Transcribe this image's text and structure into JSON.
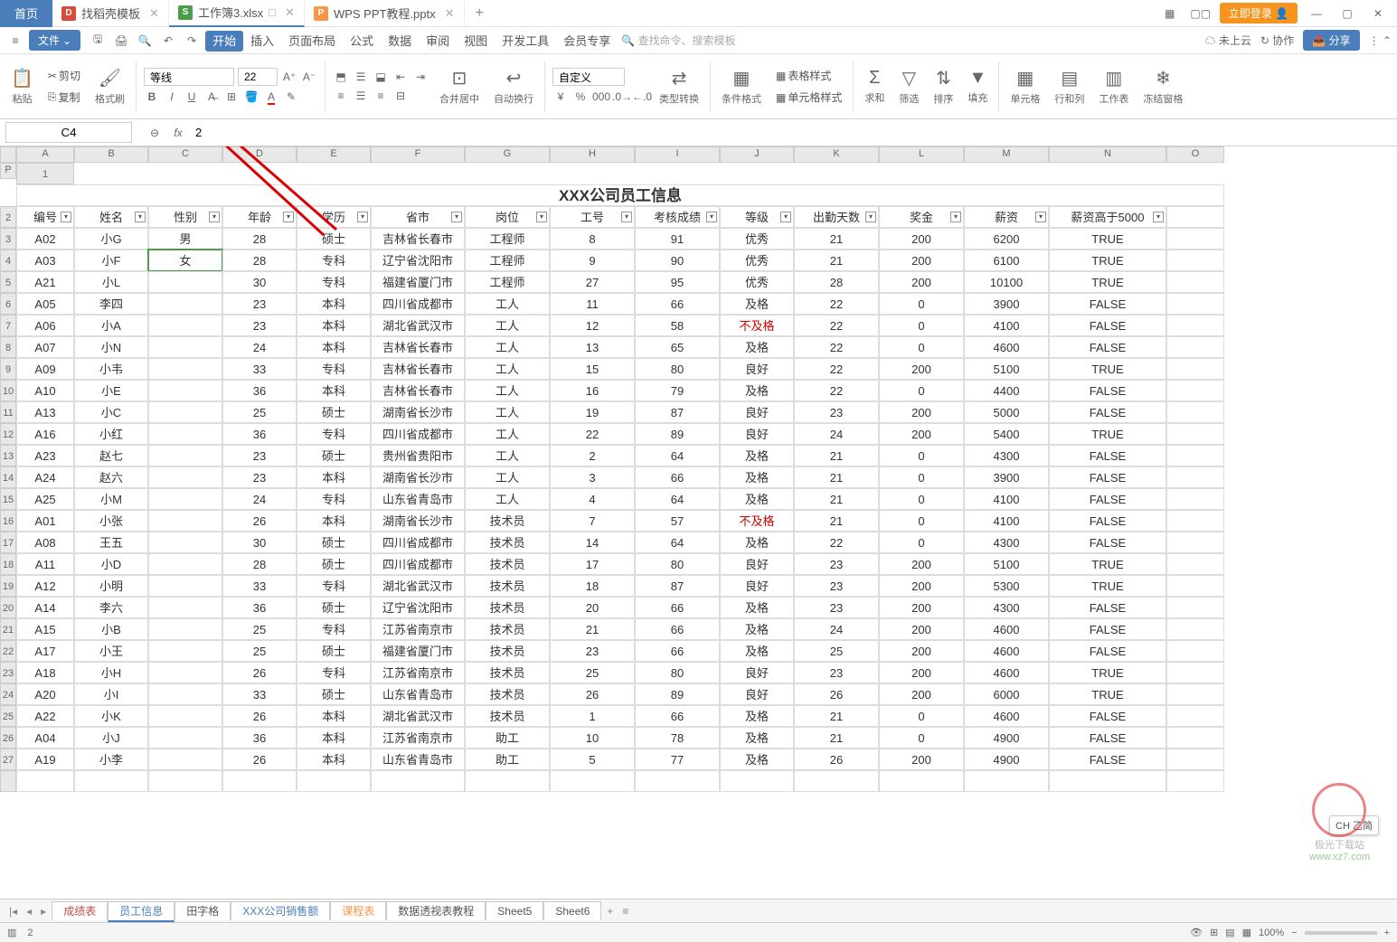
{
  "titlebar": {
    "home": "首页",
    "tabs": [
      {
        "icon_bg": "#d94b3a",
        "icon_text": "D",
        "label": "找稻壳模板"
      },
      {
        "icon_bg": "#4a9e4a",
        "icon_text": "S",
        "label": "工作簿3.xlsx",
        "active": true,
        "modified": "□"
      },
      {
        "icon_bg": "#f79646",
        "icon_text": "P",
        "label": "WPS PPT教程.pptx"
      }
    ],
    "login": "立即登录",
    "minimize": "—",
    "maximize": "▢",
    "close": "✕"
  },
  "menubar": {
    "file": "文件",
    "tabs": [
      "开始",
      "插入",
      "页面布局",
      "公式",
      "数据",
      "审阅",
      "视图",
      "开发工具",
      "会员专享"
    ],
    "active_index": 0,
    "search_placeholder": "查找命令、搜索模板",
    "cloud": "未上云",
    "collab": "协作",
    "share": "分享"
  },
  "ribbon": {
    "cut": "剪切",
    "copy": "复制",
    "paste": "粘贴",
    "format_painter": "格式刷",
    "font_name": "等线",
    "font_size": "22",
    "merge": "合并居中",
    "wrap": "自动换行",
    "number_format": "自定义",
    "type_convert": "类型转换",
    "cond_format": "条件格式",
    "table_style": "表格样式",
    "cell_style": "单元格样式",
    "sum": "求和",
    "filter": "筛选",
    "sort": "排序",
    "fill": "填充",
    "cells": "单元格",
    "rows_cols": "行和列",
    "sheet": "工作表",
    "freeze": "冻结窗格"
  },
  "namebox": {
    "ref": "C4",
    "formula": "2"
  },
  "col_letters": [
    "",
    "A",
    "B",
    "C",
    "D",
    "E",
    "F",
    "G",
    "H",
    "I",
    "J",
    "K",
    "L",
    "M",
    "N",
    "O",
    "P"
  ],
  "title_text": "XXX公司员工信息",
  "headers": [
    "编号",
    "姓名",
    "性别",
    "年龄",
    "学历",
    "省市",
    "岗位",
    "工号",
    "考核成绩",
    "等级",
    "出勤天数",
    "奖金",
    "薪资",
    "薪资高于5000"
  ],
  "rows": [
    {
      "n": 3,
      "d": [
        "A02",
        "小G",
        "男",
        "28",
        "硕士",
        "吉林省长春市",
        "工程师",
        "8",
        "91",
        "优秀",
        "21",
        "200",
        "6200",
        "TRUE"
      ]
    },
    {
      "n": 4,
      "d": [
        "A03",
        "小F",
        "女",
        "28",
        "专科",
        "辽宁省沈阳市",
        "工程师",
        "9",
        "90",
        "优秀",
        "21",
        "200",
        "6100",
        "TRUE"
      ],
      "sel": 2
    },
    {
      "n": 5,
      "d": [
        "A21",
        "小L",
        "",
        "30",
        "专科",
        "福建省厦门市",
        "工程师",
        "27",
        "95",
        "优秀",
        "28",
        "200",
        "10100",
        "TRUE"
      ]
    },
    {
      "n": 6,
      "d": [
        "A05",
        "李四",
        "",
        "23",
        "本科",
        "四川省成都市",
        "工人",
        "11",
        "66",
        "及格",
        "22",
        "0",
        "3900",
        "FALSE"
      ]
    },
    {
      "n": 7,
      "d": [
        "A06",
        "小A",
        "",
        "23",
        "本科",
        "湖北省武汉市",
        "工人",
        "12",
        "58",
        "不及格",
        "22",
        "0",
        "4100",
        "FALSE"
      ],
      "red": 9
    },
    {
      "n": 8,
      "d": [
        "A07",
        "小N",
        "",
        "24",
        "本科",
        "吉林省长春市",
        "工人",
        "13",
        "65",
        "及格",
        "22",
        "0",
        "4600",
        "FALSE"
      ]
    },
    {
      "n": 9,
      "d": [
        "A09",
        "小韦",
        "",
        "33",
        "专科",
        "吉林省长春市",
        "工人",
        "15",
        "80",
        "良好",
        "22",
        "200",
        "5100",
        "TRUE"
      ]
    },
    {
      "n": 10,
      "d": [
        "A10",
        "小E",
        "",
        "36",
        "本科",
        "吉林省长春市",
        "工人",
        "16",
        "79",
        "及格",
        "22",
        "0",
        "4400",
        "FALSE"
      ]
    },
    {
      "n": 11,
      "d": [
        "A13",
        "小C",
        "",
        "25",
        "硕士",
        "湖南省长沙市",
        "工人",
        "19",
        "87",
        "良好",
        "23",
        "200",
        "5000",
        "FALSE"
      ]
    },
    {
      "n": 12,
      "d": [
        "A16",
        "小红",
        "",
        "36",
        "专科",
        "四川省成都市",
        "工人",
        "22",
        "89",
        "良好",
        "24",
        "200",
        "5400",
        "TRUE"
      ]
    },
    {
      "n": 13,
      "d": [
        "A23",
        "赵七",
        "",
        "23",
        "硕士",
        "贵州省贵阳市",
        "工人",
        "2",
        "64",
        "及格",
        "21",
        "0",
        "4300",
        "FALSE"
      ]
    },
    {
      "n": 14,
      "d": [
        "A24",
        "赵六",
        "",
        "23",
        "本科",
        "湖南省长沙市",
        "工人",
        "3",
        "66",
        "及格",
        "21",
        "0",
        "3900",
        "FALSE"
      ]
    },
    {
      "n": 15,
      "d": [
        "A25",
        "小M",
        "",
        "24",
        "专科",
        "山东省青岛市",
        "工人",
        "4",
        "64",
        "及格",
        "21",
        "0",
        "4100",
        "FALSE"
      ]
    },
    {
      "n": 16,
      "d": [
        "A01",
        "小张",
        "",
        "26",
        "本科",
        "湖南省长沙市",
        "技术员",
        "7",
        "57",
        "不及格",
        "21",
        "0",
        "4100",
        "FALSE"
      ],
      "red": 9
    },
    {
      "n": 17,
      "d": [
        "A08",
        "王五",
        "",
        "30",
        "硕士",
        "四川省成都市",
        "技术员",
        "14",
        "64",
        "及格",
        "22",
        "0",
        "4300",
        "FALSE"
      ]
    },
    {
      "n": 18,
      "d": [
        "A11",
        "小D",
        "",
        "28",
        "硕士",
        "四川省成都市",
        "技术员",
        "17",
        "80",
        "良好",
        "23",
        "200",
        "5100",
        "TRUE"
      ]
    },
    {
      "n": 19,
      "d": [
        "A12",
        "小明",
        "",
        "33",
        "专科",
        "湖北省武汉市",
        "技术员",
        "18",
        "87",
        "良好",
        "23",
        "200",
        "5300",
        "TRUE"
      ]
    },
    {
      "n": 20,
      "d": [
        "A14",
        "李六",
        "",
        "36",
        "硕士",
        "辽宁省沈阳市",
        "技术员",
        "20",
        "66",
        "及格",
        "23",
        "200",
        "4300",
        "FALSE"
      ]
    },
    {
      "n": 21,
      "d": [
        "A15",
        "小B",
        "",
        "25",
        "专科",
        "江苏省南京市",
        "技术员",
        "21",
        "66",
        "及格",
        "24",
        "200",
        "4600",
        "FALSE"
      ]
    },
    {
      "n": 22,
      "d": [
        "A17",
        "小王",
        "",
        "25",
        "硕士",
        "福建省厦门市",
        "技术员",
        "23",
        "66",
        "及格",
        "25",
        "200",
        "4600",
        "FALSE"
      ]
    },
    {
      "n": 23,
      "d": [
        "A18",
        "小H",
        "",
        "26",
        "专科",
        "江苏省南京市",
        "技术员",
        "25",
        "80",
        "良好",
        "23",
        "200",
        "4600",
        "TRUE"
      ]
    },
    {
      "n": 24,
      "d": [
        "A20",
        "小I",
        "",
        "33",
        "硕士",
        "山东省青岛市",
        "技术员",
        "26",
        "89",
        "良好",
        "26",
        "200",
        "6000",
        "TRUE"
      ]
    },
    {
      "n": 25,
      "d": [
        "A22",
        "小K",
        "",
        "26",
        "本科",
        "湖北省武汉市",
        "技术员",
        "1",
        "66",
        "及格",
        "21",
        "0",
        "4600",
        "FALSE"
      ]
    },
    {
      "n": 26,
      "d": [
        "A04",
        "小J",
        "",
        "36",
        "本科",
        "江苏省南京市",
        "助工",
        "10",
        "78",
        "及格",
        "21",
        "0",
        "4900",
        "FALSE"
      ]
    },
    {
      "n": 27,
      "d": [
        "A19",
        "小李",
        "",
        "26",
        "本科",
        "山东省青岛市",
        "助工",
        "5",
        "77",
        "及格",
        "26",
        "200",
        "4900",
        "FALSE"
      ]
    }
  ],
  "sheet_tabs": [
    "成绩表",
    "员工信息",
    "田字格",
    "XXX公司销售额",
    "课程表",
    "数据透视表教程",
    "Sheet5",
    "Sheet6"
  ],
  "sheet_active": 1,
  "status": {
    "left_icon": "▥",
    "value": "2",
    "zoom": "100%",
    "ime": "CH 乙简"
  },
  "watermark": {
    "site": "极光下载站",
    "url": "www.xz7.com"
  }
}
